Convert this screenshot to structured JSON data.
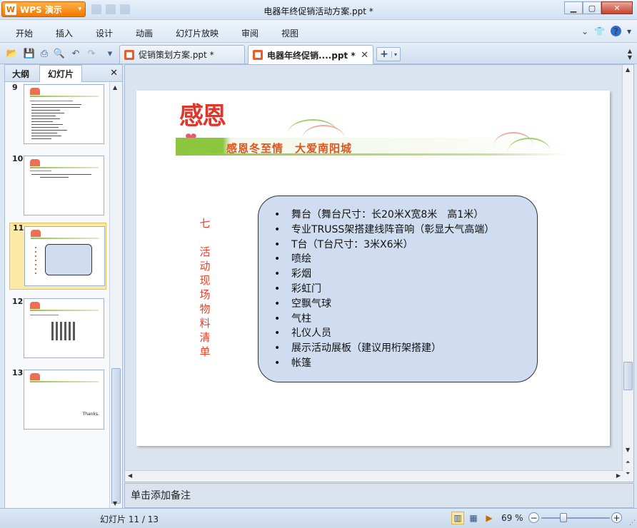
{
  "app": {
    "name_label": "WPS 演示",
    "window_title": "电器年终促销活动方案.ppt *"
  },
  "menu": [
    "开始",
    "插入",
    "设计",
    "动画",
    "幻灯片放映",
    "审阅",
    "视图"
  ],
  "tabs": [
    {
      "label": "促销策划方案.ppt *",
      "active": false
    },
    {
      "label": "电器年终促销....ppt *",
      "active": true
    }
  ],
  "left_panel": {
    "tab_outline": "大纲",
    "tab_slides": "幻灯片",
    "thumbnails": [
      {
        "number": "9"
      },
      {
        "number": "10"
      },
      {
        "number": "11",
        "selected": true
      },
      {
        "number": "12"
      },
      {
        "number": "13",
        "text": "Thanks."
      }
    ]
  },
  "slide": {
    "logo_text": "感恩",
    "banner_text": "感恩冬至情　大爱南阳城",
    "section_number": "七",
    "section_title_chars": [
      "活",
      "动",
      "现",
      "场",
      "物",
      "料",
      "清",
      "单"
    ],
    "items": [
      "舞台（舞台尺寸：长20米X宽8米　高1米）",
      "专业TRUSS架搭建线阵音响（彰显大气高端）",
      "T台（T台尺寸：3米X6米）",
      "喷绘",
      "彩烟",
      "彩虹门",
      "空飘气球",
      "气柱",
      "礼仪人员",
      "展示活动展板（建议用桁架搭建）",
      "帐篷"
    ]
  },
  "notes_placeholder": "单击添加备注",
  "status": {
    "slide_indicator": "幻灯片 11 / 13",
    "zoom": "69 %"
  },
  "colors": {
    "accent_red": "#e8402c",
    "banner_green": "#8cc63f",
    "list_box_fill": "#d0dcf0"
  }
}
